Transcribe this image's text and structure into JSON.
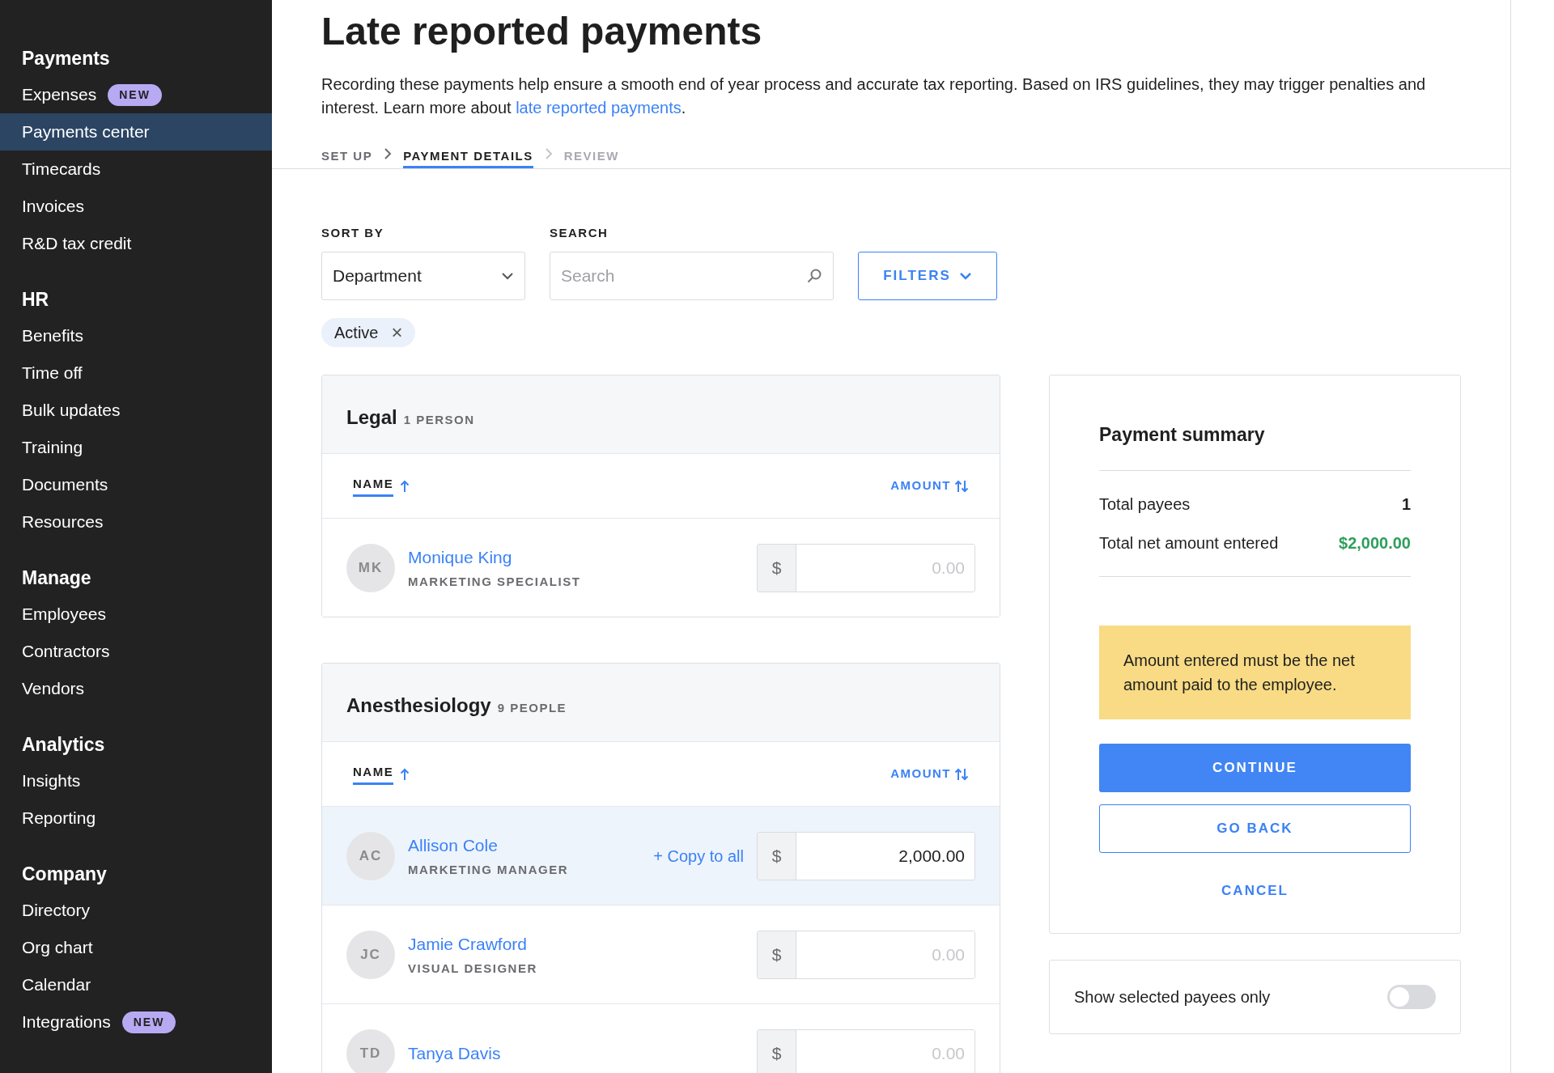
{
  "sidebar": {
    "sections": [
      {
        "title": "Payments",
        "items": [
          {
            "label": "Expenses",
            "badge": "NEW",
            "selected": false
          },
          {
            "label": "Payments center",
            "selected": true
          },
          {
            "label": "Timecards",
            "selected": false
          },
          {
            "label": "Invoices",
            "selected": false
          },
          {
            "label": "R&D tax credit",
            "selected": false
          }
        ]
      },
      {
        "title": "HR",
        "items": [
          {
            "label": "Benefits",
            "selected": false
          },
          {
            "label": "Time off",
            "selected": false
          },
          {
            "label": "Bulk updates",
            "selected": false
          },
          {
            "label": "Training",
            "selected": false
          },
          {
            "label": "Documents",
            "selected": false
          },
          {
            "label": "Resources",
            "selected": false
          }
        ]
      },
      {
        "title": "Manage",
        "items": [
          {
            "label": "Employees",
            "selected": false
          },
          {
            "label": "Contractors",
            "selected": false
          },
          {
            "label": "Vendors",
            "selected": false
          }
        ]
      },
      {
        "title": "Analytics",
        "items": [
          {
            "label": "Insights",
            "selected": false
          },
          {
            "label": "Reporting",
            "selected": false
          }
        ]
      },
      {
        "title": "Company",
        "items": [
          {
            "label": "Directory",
            "selected": false
          },
          {
            "label": "Org chart",
            "selected": false
          },
          {
            "label": "Calendar",
            "selected": false
          },
          {
            "label": "Integrations",
            "badge": "NEW",
            "selected": false
          }
        ]
      }
    ]
  },
  "page": {
    "title": "Late reported payments",
    "description": "Recording these payments help ensure a smooth end of year process and accurate tax reporting. Based on IRS guidelines, they may trigger penalties and interest. Learn more about ",
    "link": "late reported payments",
    "description_end": ".",
    "steps": [
      {
        "label": "SET UP",
        "selected": false,
        "disabled": false
      },
      {
        "label": "PAYMENT DETAILS",
        "selected": true,
        "disabled": false
      },
      {
        "label": "REVIEW",
        "selected": false,
        "disabled": true
      }
    ]
  },
  "controls": {
    "sort_label": "SORT BY",
    "sort_value": "Department",
    "search_label": "SEARCH",
    "search_placeholder": "Search",
    "filters_button": "FILTERS",
    "chips": [
      {
        "label": "Active",
        "remove": "×"
      }
    ]
  },
  "groups": [
    {
      "name": "Legal",
      "count": "1 PERSON",
      "name_column": "NAME",
      "amount_column": "AMOUNT",
      "people": [
        {
          "initials": "MK",
          "name": "Monique King",
          "role": "MARKETING SPECIALIST",
          "currency": "$",
          "amount_placeholder": "0.00",
          "selected": false
        }
      ]
    },
    {
      "name": "Anesthesiology",
      "count": "9 PEOPLE",
      "name_column": "NAME",
      "amount_column": "AMOUNT",
      "people": [
        {
          "initials": "AC",
          "name": "Allison Cole",
          "role": "MARKETING MANAGER",
          "currency": "$",
          "amount": "2,000.00",
          "copy_all": "+ Copy to all",
          "selected": true
        },
        {
          "initials": "JC",
          "name": "Jamie Crawford",
          "role": "VISUAL DESIGNER",
          "currency": "$",
          "amount_placeholder": "0.00",
          "selected": false
        },
        {
          "initials": "TD",
          "name": "Tanya Davis",
          "currency": "$",
          "amount_placeholder": "0.00",
          "selected": false
        }
      ]
    }
  ],
  "summary": {
    "title": "Payment summary",
    "rows": [
      {
        "label": "Total payees",
        "value": "1",
        "kind": "plain"
      },
      {
        "label": "Total net amount entered",
        "value": "$2,000.00",
        "kind": "money"
      }
    ],
    "notice": "Amount entered must be the net amount paid to the employee.",
    "continue": "CONTINUE",
    "go_back": "GO BACK",
    "cancel": "CANCEL"
  },
  "toggle": {
    "label": "Show selected payees only",
    "on": false
  }
}
